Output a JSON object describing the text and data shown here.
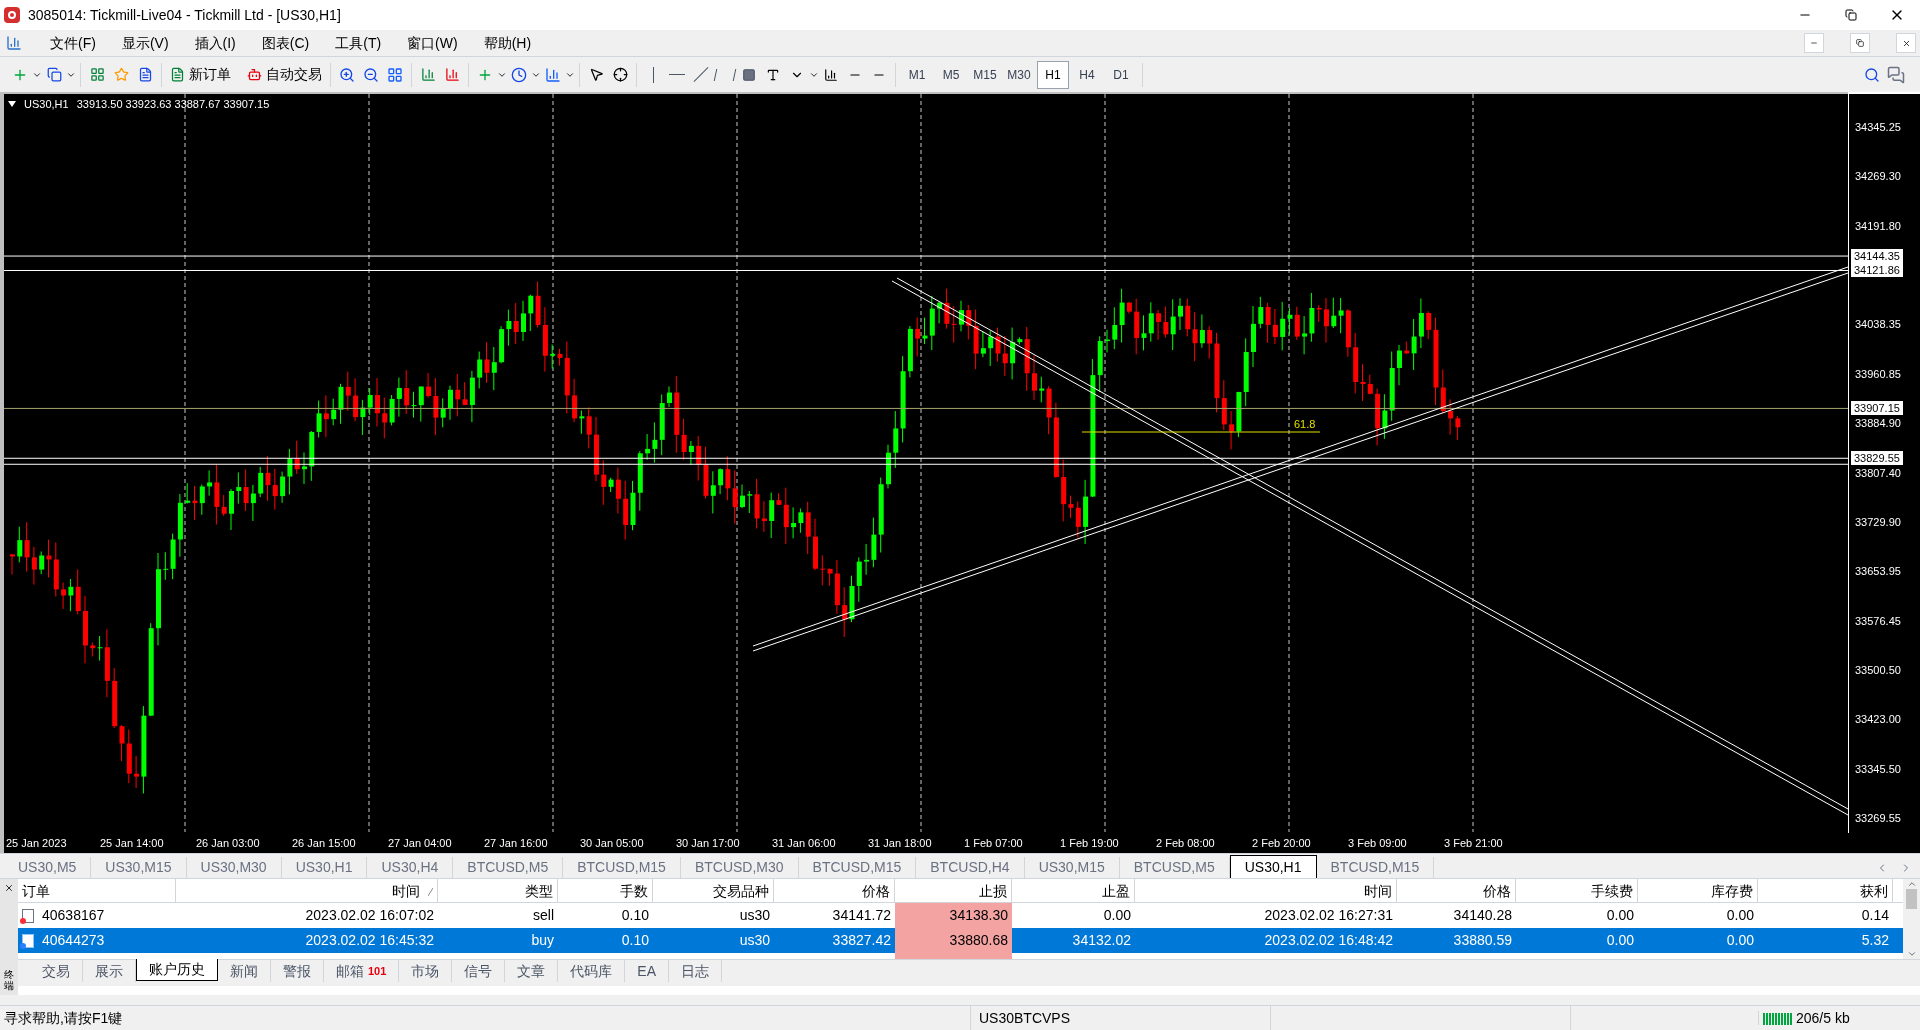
{
  "window": {
    "title": "3085014: Tickmill-Live04 - Tickmill Ltd - [US30,H1]"
  },
  "menu": [
    "文件(F)",
    "显示(V)",
    "插入(I)",
    "图表(C)",
    "工具(T)",
    "窗口(W)",
    "帮助(H)"
  ],
  "toolbar": {
    "buttons": [
      "新订单",
      "自动交易"
    ],
    "timeframes": [
      {
        "label": "M1",
        "selected": false
      },
      {
        "label": "M5",
        "selected": false
      },
      {
        "label": "M15",
        "selected": false
      },
      {
        "label": "M30",
        "selected": false
      },
      {
        "label": "H1",
        "selected": true
      },
      {
        "label": "H4",
        "selected": false
      },
      {
        "label": "D1",
        "selected": false
      }
    ]
  },
  "chart": {
    "symbol": "US30,H1",
    "ohlc": "33913.50 33923.63 33887.67 33907.15",
    "price_ticks": [
      "34345.25",
      "34269.30",
      "34191.80",
      "34038.35",
      "33960.85",
      "33884.90",
      "33807.40",
      "33729.90",
      "33653.95",
      "33576.45",
      "33500.50",
      "33423.00",
      "33345.50",
      "33269.55"
    ],
    "price_markers": [
      "34144.35",
      "34121.86",
      "33907.15",
      "33829.55"
    ],
    "time_labels": [
      "25 Jan 2023",
      "25 Jan 14:00",
      "26 Jan 03:00",
      "26 Jan 15:00",
      "27 Jan 04:00",
      "27 Jan 16:00",
      "30 Jan 05:00",
      "30 Jan 17:00",
      "31 Jan 06:00",
      "31 Jan 18:00",
      "1 Feb 07:00",
      "1 Feb 19:00",
      "2 Feb 08:00",
      "2 Feb 20:00",
      "3 Feb 09:00",
      "3 Feb 21:00"
    ],
    "fib_label": "61.8"
  },
  "symbol_tabs": [
    {
      "label": "US30,M5",
      "selected": false
    },
    {
      "label": "US30,M15",
      "selected": false
    },
    {
      "label": "US30,M30",
      "selected": false
    },
    {
      "label": "US30,H1",
      "selected": false
    },
    {
      "label": "US30,H4",
      "selected": false
    },
    {
      "label": "BTCUSD,M5",
      "selected": false
    },
    {
      "label": "BTCUSD,M15",
      "selected": false
    },
    {
      "label": "BTCUSD,M30",
      "selected": false
    },
    {
      "label": "BTCUSD,M15",
      "selected": false
    },
    {
      "label": "BTCUSD,H4",
      "selected": false
    },
    {
      "label": "US30,M15",
      "selected": false
    },
    {
      "label": "BTCUSD,M5",
      "selected": false
    },
    {
      "label": "US30,H1",
      "selected": true
    },
    {
      "label": "BTCUSD,M15",
      "selected": false
    }
  ],
  "terminal": {
    "side_label": "终端",
    "columns": [
      "订单",
      "时间",
      "类型",
      "手数",
      "交易品种",
      "价格",
      "止损",
      "止盈",
      "时间",
      "价格",
      "手续费",
      "库存费",
      "获利"
    ],
    "rows": [
      {
        "kind": "sell",
        "selected": false,
        "cells": [
          "40638167",
          "2023.02.02 16:07:02",
          "sell",
          "0.10",
          "us30",
          "34141.72",
          "34138.30",
          "0.00",
          "2023.02.02 16:27:31",
          "34140.28",
          "0.00",
          "0.00",
          "0.14"
        ]
      },
      {
        "kind": "buy",
        "selected": true,
        "cells": [
          "40644273",
          "2023.02.02 16:45:32",
          "buy",
          "0.10",
          "us30",
          "33827.42",
          "33880.68",
          "34132.02",
          "2023.02.02 16:48:42",
          "33880.59",
          "0.00",
          "0.00",
          "5.32"
        ]
      }
    ],
    "tabs": [
      {
        "label": "交易",
        "selected": false
      },
      {
        "label": "展示",
        "selected": false
      },
      {
        "label": "账户历史",
        "selected": true
      },
      {
        "label": "新闻",
        "selected": false
      },
      {
        "label": "警报",
        "selected": false
      },
      {
        "label": "邮箱",
        "selected": false,
        "badge": "101"
      },
      {
        "label": "市场",
        "selected": false
      },
      {
        "label": "信号",
        "selected": false
      },
      {
        "label": "文章",
        "selected": false
      },
      {
        "label": "代码库",
        "selected": false
      },
      {
        "label": "EA",
        "selected": false
      },
      {
        "label": "日志",
        "selected": false
      }
    ]
  },
  "status_bar": {
    "help": "寻求帮助,请按F1键",
    "server": "US30BTCVPS",
    "traffic": "206/5 kb"
  }
}
